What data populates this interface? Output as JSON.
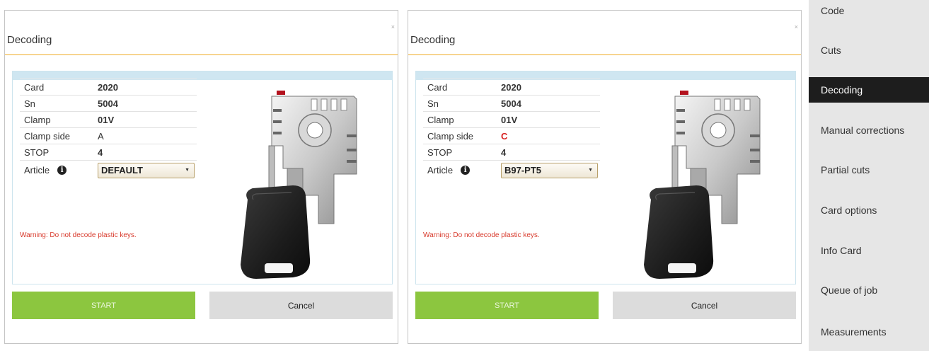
{
  "dialogs": [
    {
      "title": "Decoding",
      "close_glyph": "×",
      "rows": [
        {
          "label": "Card",
          "value": "2020"
        },
        {
          "label": "Sn",
          "value": "5004"
        },
        {
          "label": "Clamp",
          "value": "01V"
        },
        {
          "label": "Clamp side",
          "value": "A"
        },
        {
          "label": "STOP",
          "value": "4"
        }
      ],
      "article_label": "Article",
      "article_value": "DEFAULT",
      "warning": "Warning: Do not decode plastic keys.",
      "start_label": "START",
      "cancel_label": "Cancel"
    },
    {
      "title": "Decoding",
      "close_glyph": "×",
      "rows": [
        {
          "label": "Card",
          "value": "2020"
        },
        {
          "label": "Sn",
          "value": "5004"
        },
        {
          "label": "Clamp",
          "value": "01V"
        },
        {
          "label": "Clamp side",
          "value": "C"
        },
        {
          "label": "STOP",
          "value": "4"
        }
      ],
      "article_label": "Article",
      "article_value": "B97-PT5",
      "warning": "Warning: Do not decode plastic keys.",
      "start_label": "START",
      "cancel_label": "Cancel"
    }
  ],
  "sidebar": {
    "items": [
      {
        "label": "Code",
        "active": false
      },
      {
        "label": "Cuts",
        "active": false
      },
      {
        "label": "Decoding",
        "active": true
      },
      {
        "label": "Manual corrections",
        "active": false
      },
      {
        "label": "Partial cuts",
        "active": false
      },
      {
        "label": "Card options",
        "active": false
      },
      {
        "label": "Info Card",
        "active": false
      },
      {
        "label": "Queue of job",
        "active": false
      },
      {
        "label": "Measurements",
        "active": false
      }
    ]
  },
  "colors": {
    "accent_rule": "#f0ad29",
    "start_button": "#8cc63f",
    "warning_text": "#d83a2c",
    "highlight_value": "#d72020",
    "sidebar_active": "#1d1d1d"
  },
  "icons": {
    "info": "info-circle-icon",
    "close": "close-icon",
    "select_caret": "caret-down-icon",
    "key_illustration": "key-in-clamp-illustration"
  }
}
